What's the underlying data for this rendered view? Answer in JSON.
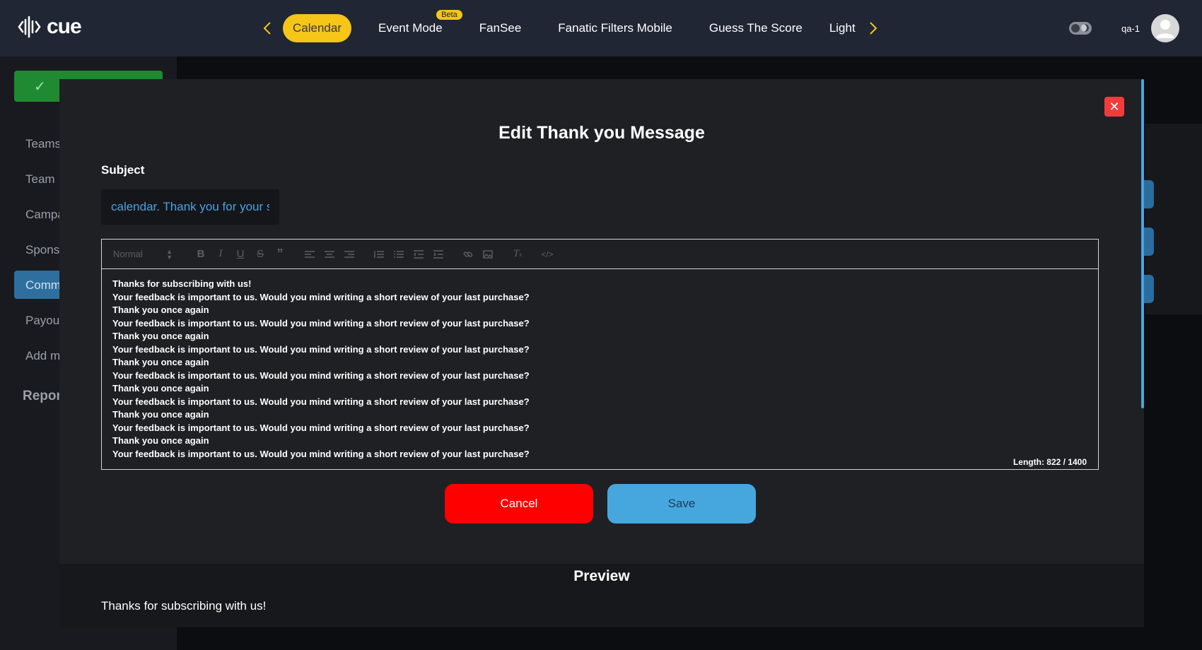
{
  "app": {
    "logo_text": "cue"
  },
  "nav": {
    "tabs": [
      {
        "label": "Calendar",
        "active": true
      },
      {
        "label": "Event Mode",
        "badge": "Beta"
      },
      {
        "label": "FanSee"
      },
      {
        "label": "Fanatic Filters Mobile"
      },
      {
        "label": "Guess The Score"
      },
      {
        "label": "Light"
      }
    ]
  },
  "user": {
    "name": "qa-1"
  },
  "sidebar": {
    "items": [
      "Teams",
      "Team",
      "Campa",
      "Spons",
      "Comm",
      "Payou",
      "Add m"
    ],
    "section": "Repor"
  },
  "modal": {
    "title": "Edit Thank you Message",
    "subject_label": "Subject",
    "subject_value": "calendar. Thank you for your s",
    "toolbar_format": "Normal",
    "body_lines": [
      "Thanks for subscribing with us!",
      "Your feedback is important to us. Would you mind writing a short review of your last purchase?",
      "Thank you once again",
      "Your feedback is important to us. Would you mind writing a short review of your last purchase?",
      "Thank you once again",
      "Your feedback is important to us. Would you mind writing a short review of your last purchase?",
      "Thank you once again",
      "Your feedback is important to us. Would you mind writing a short review of your last purchase?",
      "Thank you once again",
      "Your feedback is important to us. Would you mind writing a short review of your last purchase?",
      "Thank you once again",
      "Your feedback is important to us. Would you mind writing a short review of your last purchase?",
      "Thank you once again",
      "Your feedback is important to us. Would you mind writing a short review of your last purchase?"
    ],
    "length_text": "Length: 822 / 1400",
    "cancel_label": "Cancel",
    "save_label": "Save",
    "preview_title": "Preview",
    "preview_text": "Thanks for subscribing with us!"
  },
  "colors": {
    "accent_yellow": "#f5c518",
    "cancel_red": "#ff0000",
    "save_blue": "#46a7df",
    "subject_text_blue": "#4aa3e0"
  }
}
